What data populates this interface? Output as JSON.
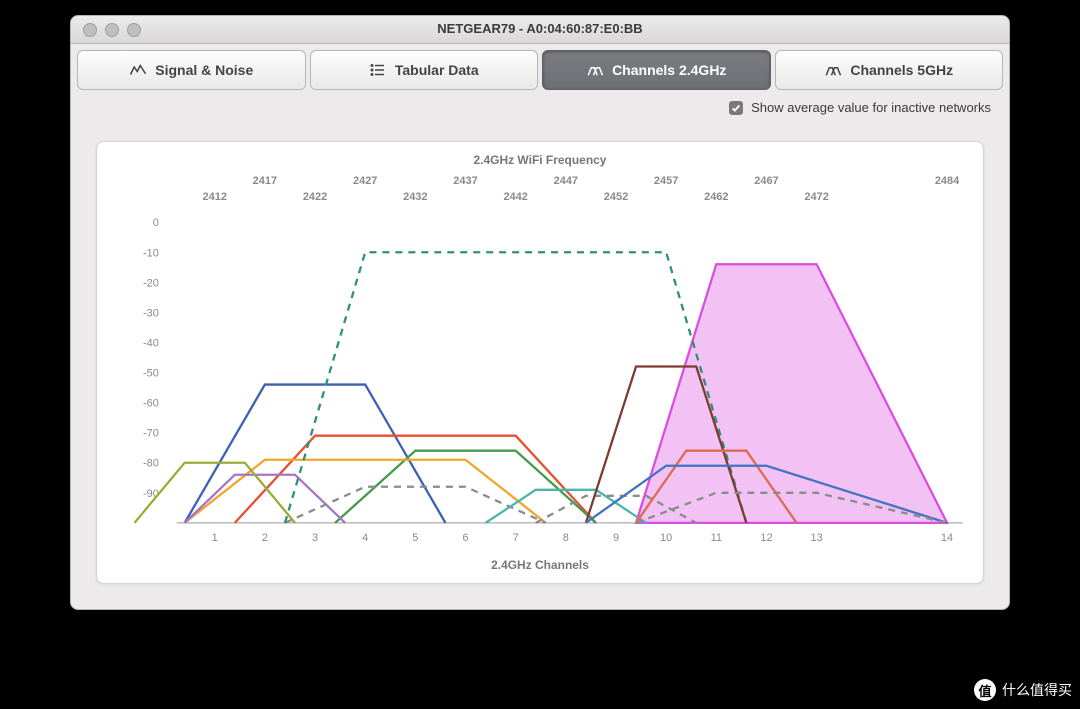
{
  "window": {
    "title": "NETGEAR79 - A0:04:60:87:E0:BB"
  },
  "tabs": [
    {
      "label": "Signal & Noise"
    },
    {
      "label": "Tabular Data"
    },
    {
      "label": "Channels 2.4GHz",
      "active": true
    },
    {
      "label": "Channels 5GHz"
    }
  ],
  "checkbox": {
    "label": "Show average value for inactive networks",
    "checked": true
  },
  "chart_data": {
    "type": "area",
    "title": "2.4GHz WiFi Frequency",
    "xlabel": "2.4GHz Channels",
    "ylabel": "",
    "ylim": [
      -100,
      0
    ],
    "yticks": [
      0,
      -10,
      -20,
      -30,
      -40,
      -50,
      -60,
      -70,
      -80,
      -90
    ],
    "channels": [
      1,
      2,
      3,
      4,
      5,
      6,
      7,
      8,
      9,
      10,
      11,
      12,
      13,
      14
    ],
    "frequencies": [
      2412,
      2417,
      2422,
      2427,
      2432,
      2437,
      2442,
      2447,
      2452,
      2457,
      2462,
      2467,
      2472,
      2484
    ],
    "series": [
      {
        "name": "net-blue",
        "color": "#3b60b6",
        "center_channel": 3,
        "half_width_ch": 2,
        "peak_db": -54,
        "style": "solid",
        "fill": false
      },
      {
        "name": "net-red",
        "color": "#e8502f",
        "center_channel": 5,
        "half_width_ch": 3,
        "peak_db": -71,
        "style": "solid",
        "fill": false
      },
      {
        "name": "net-green",
        "color": "#449a4b",
        "center_channel": 6,
        "half_width_ch": 2,
        "peak_db": -76,
        "style": "solid",
        "fill": false
      },
      {
        "name": "net-orange",
        "color": "#f1a62b",
        "center_channel": 4,
        "half_width_ch": 3,
        "peak_db": -79,
        "style": "solid",
        "fill": false
      },
      {
        "name": "net-mauve",
        "color": "#a776c6",
        "center_channel": 2,
        "half_width_ch": 1,
        "peak_db": -84,
        "style": "solid",
        "fill": false
      },
      {
        "name": "net-olive1",
        "color": "#9aad37",
        "center_channel": 1,
        "half_width_ch": 1,
        "peak_db": -80,
        "style": "solid",
        "fill": false
      },
      {
        "name": "net-gray-dash",
        "color": "#8b8b8b",
        "center_channel": 5,
        "half_width_ch": 2,
        "peak_db": -88,
        "style": "dashed",
        "fill": false
      },
      {
        "name": "net-aqua1",
        "color": "#4cb5aa",
        "center_channel": 8,
        "half_width_ch": 1,
        "peak_db": -89,
        "style": "solid",
        "fill": false
      },
      {
        "name": "net-gray-dash2",
        "color": "#8b8b8b",
        "center_channel": 9,
        "half_width_ch": 1,
        "peak_db": -91,
        "style": "dashed",
        "fill": false
      },
      {
        "name": "net-teal-dash",
        "color": "#2f8f78",
        "center_channel": 7,
        "half_width_ch": 4,
        "peak_db": -10,
        "style": "dashed",
        "fill": false
      },
      {
        "name": "net-brown",
        "color": "#7e3c2f",
        "center_channel": 10,
        "half_width_ch": 1,
        "peak_db": -48,
        "style": "solid",
        "fill": false
      },
      {
        "name": "net-coral",
        "color": "#e06a4f",
        "center_channel": 11,
        "half_width_ch": 1,
        "peak_db": -76,
        "style": "solid",
        "fill": false
      },
      {
        "name": "net-blue2",
        "color": "#4474c0",
        "center_channel": 11,
        "half_width_ch": 2,
        "peak_db": -81,
        "style": "solid",
        "fill": false
      },
      {
        "name": "net-gray-dash3",
        "color": "#8b8b8b",
        "center_channel": 12,
        "half_width_ch": 2,
        "peak_db": -90,
        "style": "dashed",
        "fill": false
      },
      {
        "name": "net-magenta",
        "color": "#d94fe0",
        "center_channel": 12,
        "half_width_ch": 2,
        "peak_db": -14,
        "style": "solid",
        "fill": true
      }
    ]
  },
  "watermark": {
    "text": "什么值得买",
    "badge": "值"
  }
}
